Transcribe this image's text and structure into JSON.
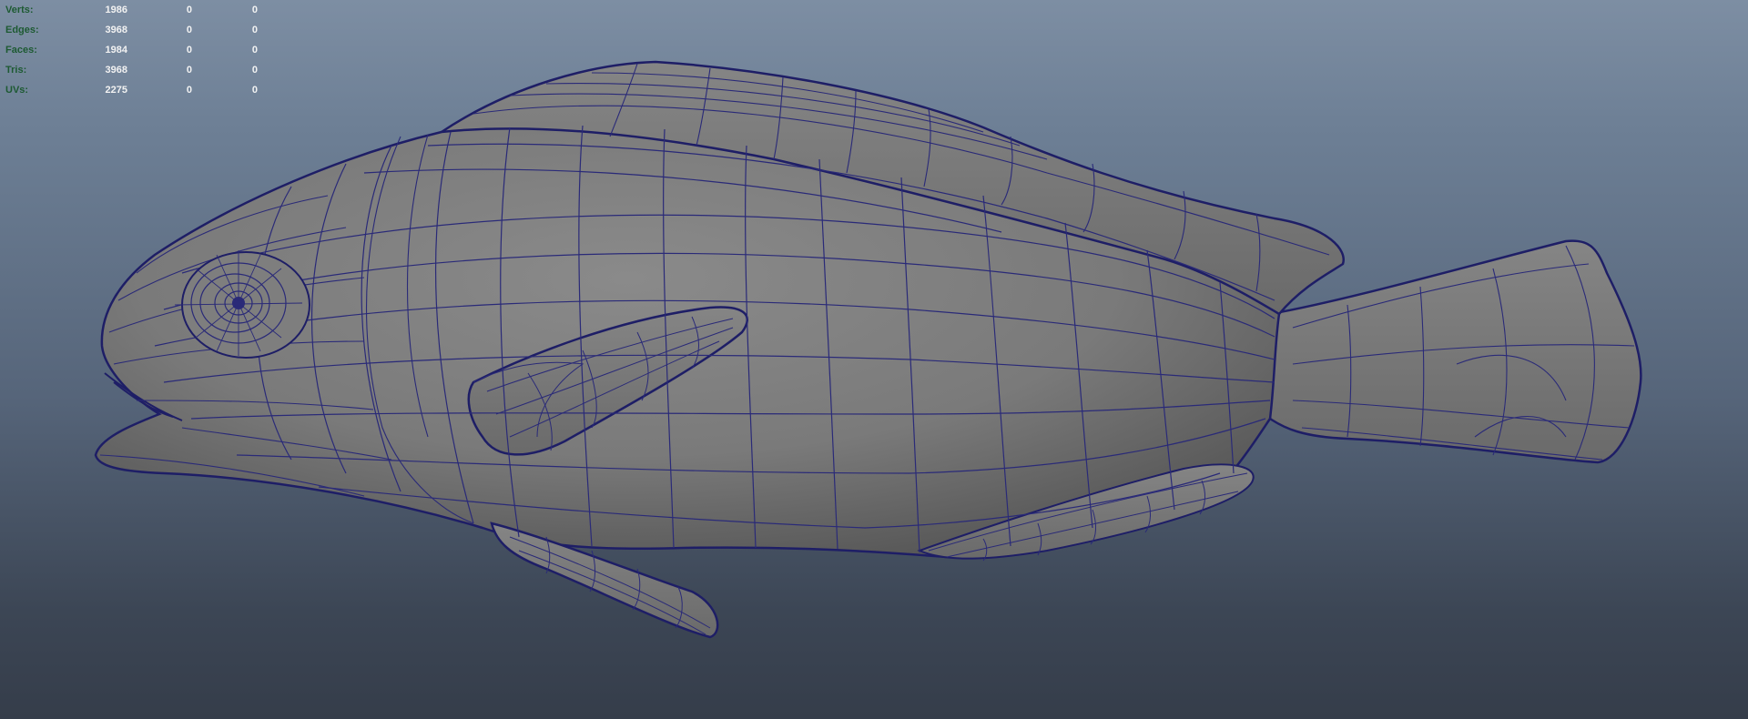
{
  "heads_up_display": {
    "rows": [
      {
        "label": "Verts:",
        "total": "1986",
        "selected": "0",
        "highlighted": "0"
      },
      {
        "label": "Edges:",
        "total": "3968",
        "selected": "0",
        "highlighted": "0"
      },
      {
        "label": "Faces:",
        "total": "1984",
        "selected": "0",
        "highlighted": "0"
      },
      {
        "label": "Tris:",
        "total": "3968",
        "selected": "0",
        "highlighted": "0"
      },
      {
        "label": "UVs:",
        "total": "2275",
        "selected": "0",
        "highlighted": "0"
      }
    ]
  },
  "viewport": {
    "background_top": "#7d8ea3",
    "background_bottom": "#353d4a",
    "model": "fish-wireframe-mesh",
    "mesh_fill": "#7a7a7a",
    "wire_color": "#23236e"
  }
}
